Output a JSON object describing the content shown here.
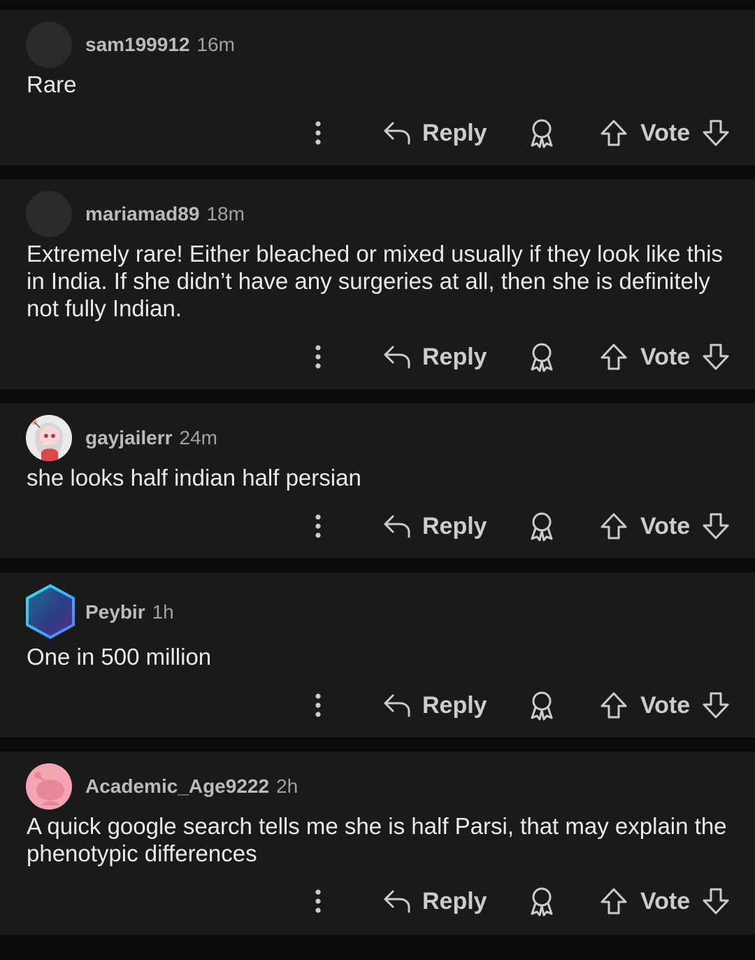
{
  "actions": {
    "reply_label": "Reply",
    "vote_label": "Vote"
  },
  "icons": {
    "more": "more-vertical-icon",
    "reply": "reply-arrow-icon",
    "award": "award-icon",
    "upvote": "upvote-arrow-icon",
    "downvote": "downvote-arrow-icon"
  },
  "colors": {
    "background": "#0b0b0b",
    "card": "#1a1a1b",
    "text": "#e8eaec",
    "muted": "#9ea2a5"
  },
  "comments": [
    {
      "username": "sam199912",
      "time": "16m",
      "body": "Rare",
      "avatar": "default-avatar"
    },
    {
      "username": "mariamad89",
      "time": "18m",
      "body": "Extremely rare! Either bleached or mixed usually if they look like this in India. If she didn’t have any surgeries at all, then she is definitely not fully Indian.",
      "avatar": "default-avatar"
    },
    {
      "username": "gayjailerr",
      "time": "24m",
      "body": "she looks half indian half persian",
      "avatar": "cartoon-character-avatar"
    },
    {
      "username": "Peybir",
      "time": "1h",
      "body": "One in 500 million",
      "avatar": "hexagon-nft-avatar"
    },
    {
      "username": "Academic_Age9222",
      "time": "2h",
      "body": "A quick google search tells me she is half Parsi, that may explain the phenotypic differences",
      "avatar": "pink-snoo-avatar"
    }
  ]
}
